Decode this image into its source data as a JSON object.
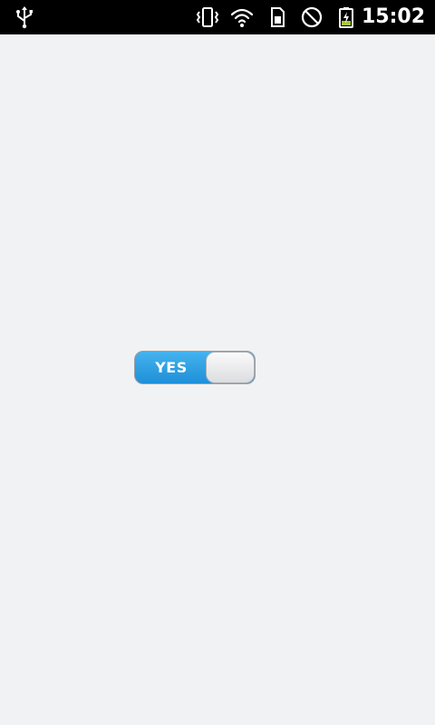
{
  "status_bar": {
    "time": "15:02",
    "icons": [
      "usb-icon",
      "vibrate-icon",
      "wifi-icon",
      "sim-card-icon",
      "no-signal-icon",
      "battery-charging-icon"
    ],
    "battery_color": "#a4c639"
  },
  "toggle": {
    "label": "YES",
    "state": "on",
    "accent_color": "#2c9de3"
  }
}
